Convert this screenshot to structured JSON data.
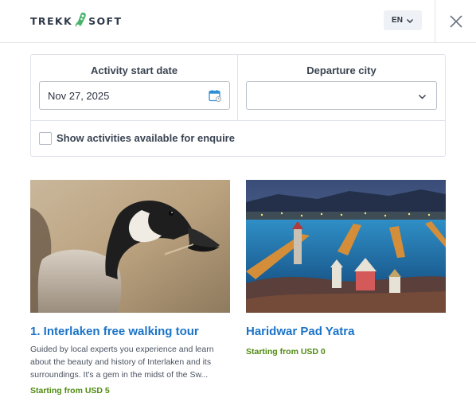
{
  "header": {
    "logo_left": "TREKK",
    "logo_right": "SOFT",
    "language": "EN",
    "language_icon": "chevron-down-icon",
    "close_icon": "close-icon"
  },
  "filters": {
    "start_date_label": "Activity start date",
    "start_date_value": "Nov 27, 2025",
    "calendar_icon": "calendar-icon",
    "departure_label": "Departure city",
    "departure_value": "",
    "enquire_label": "Show activities available for enquire",
    "enquire_checked": false
  },
  "activities": [
    {
      "title": "1. Interlaken free walking tour",
      "description": "Guided by local experts you experience and learn about the beauty and history of Interlaken and its surroundings. It's a gem in the midst of the Sw...",
      "price": "Starting from USD 5"
    },
    {
      "title": "Haridwar Pad Yatra",
      "description": "",
      "price": "Starting from USD 0"
    }
  ],
  "colors": {
    "link": "#1a73c8",
    "price": "#4f8a10",
    "border": "#dfe3e8",
    "logo_green": "#49b36c"
  }
}
